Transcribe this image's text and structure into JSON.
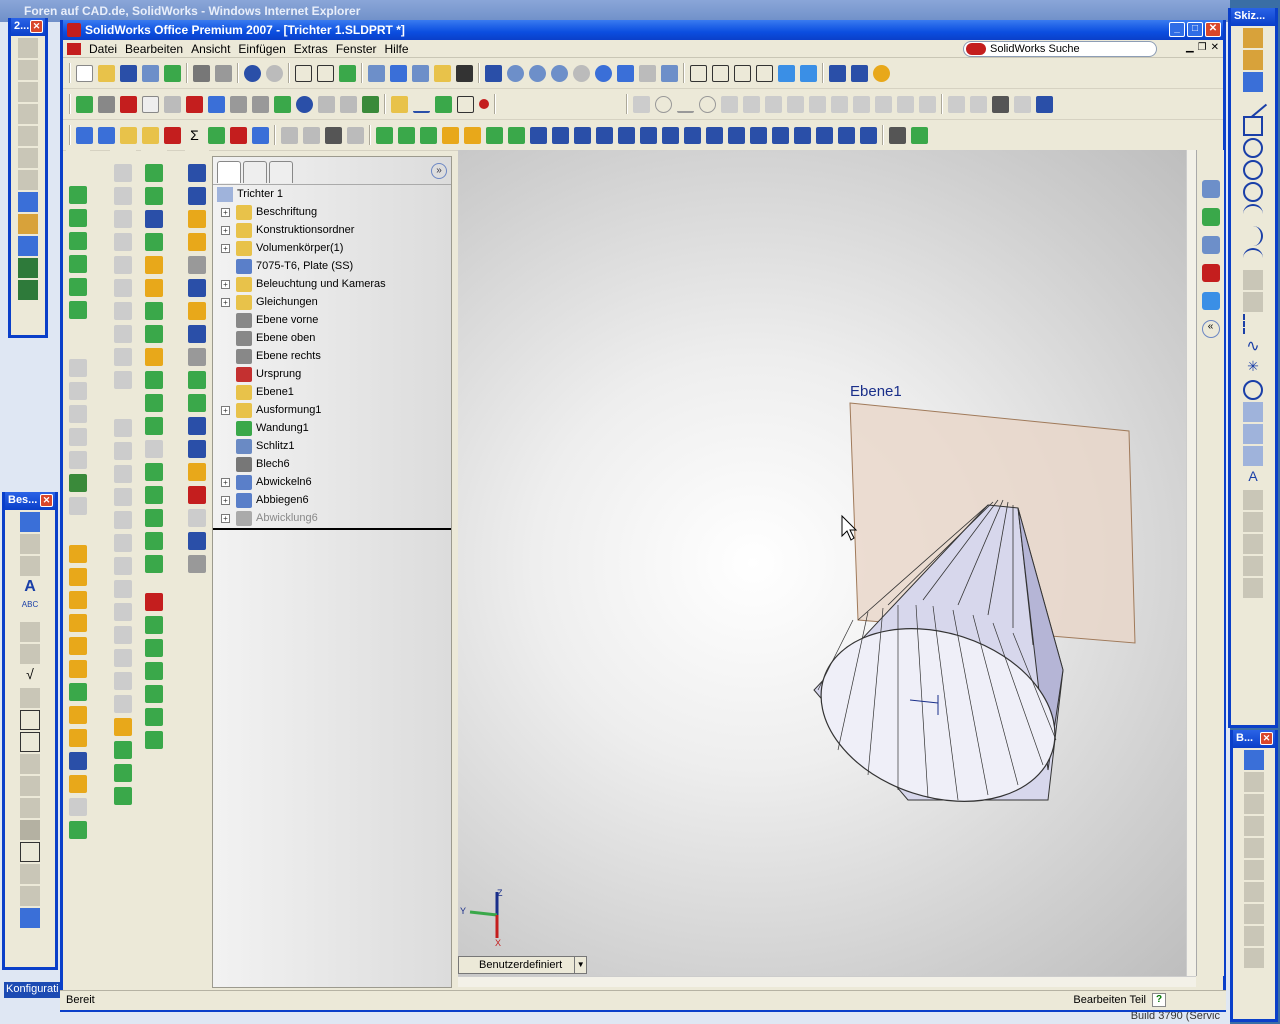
{
  "background_window": {
    "title": "Foren auf CAD.de, SolidWorks - Windows Internet Explorer",
    "status_tail": "Build 3790 (Servic",
    "taskbar_item": "Konfigurati"
  },
  "floating_toolbars": {
    "left_top_title": "2...",
    "left_bottom_title": "Bes...",
    "right_top_title": "Skiz...",
    "right_bottom_title": "B..."
  },
  "window": {
    "title": "SolidWorks Office Premium 2007 - [Trichter 1.SLDPRT *]",
    "minimize": "_",
    "maximize": "□",
    "close": "✕"
  },
  "menu": {
    "items": [
      "Datei",
      "Bearbeiten",
      "Ansicht",
      "Einfügen",
      "Extras",
      "Fenster",
      "Hilfe"
    ],
    "search_label": "SolidWorks Suche"
  },
  "feature_tree": {
    "root": "Trichter 1",
    "items": [
      {
        "label": "Beschriftung",
        "expandable": true,
        "icon": "annotation-icon",
        "color": "#e8c24a"
      },
      {
        "label": "Konstruktionsordner",
        "expandable": true,
        "icon": "design-binder-icon",
        "color": "#e8c24a"
      },
      {
        "label": "Volumenkörper(1)",
        "expandable": true,
        "icon": "solid-bodies-icon",
        "color": "#e8c24a"
      },
      {
        "label": "7075-T6, Plate (SS)",
        "expandable": false,
        "icon": "material-icon",
        "color": "#5a7fc9"
      },
      {
        "label": "Beleuchtung und Kameras",
        "expandable": true,
        "icon": "lights-icon",
        "color": "#e8c24a"
      },
      {
        "label": "Gleichungen",
        "expandable": true,
        "icon": "equations-icon",
        "color": "#e8c24a"
      },
      {
        "label": "Ebene vorne",
        "expandable": false,
        "icon": "plane-icon",
        "color": "#888888"
      },
      {
        "label": "Ebene oben",
        "expandable": false,
        "icon": "plane-icon",
        "color": "#888888"
      },
      {
        "label": "Ebene rechts",
        "expandable": false,
        "icon": "plane-icon",
        "color": "#888888"
      },
      {
        "label": "Ursprung",
        "expandable": false,
        "icon": "origin-icon",
        "color": "#c43030"
      },
      {
        "label": "Ebene1",
        "expandable": false,
        "icon": "plane-icon",
        "color": "#e8c24a"
      },
      {
        "label": "Ausformung1",
        "expandable": true,
        "icon": "loft-icon",
        "color": "#e8c24a"
      },
      {
        "label": "Wandung1",
        "expandable": false,
        "icon": "shell-icon",
        "color": "#3aa84a"
      },
      {
        "label": "Schlitz1",
        "expandable": false,
        "icon": "rip-icon",
        "color": "#6a8ac4"
      },
      {
        "label": "Blech6",
        "expandable": false,
        "icon": "sheet-metal-icon",
        "color": "#777777"
      },
      {
        "label": "Abwickeln6",
        "expandable": true,
        "icon": "unfold-icon",
        "color": "#5a7fc9"
      },
      {
        "label": "Abbiegen6",
        "expandable": true,
        "icon": "fold-icon",
        "color": "#5a7fc9"
      },
      {
        "label": "Abwicklung6",
        "expandable": true,
        "icon": "flat-pattern-icon",
        "color": "#aaaaaa",
        "dimmed": true
      }
    ]
  },
  "viewport": {
    "plane_label": "Ebene1",
    "triad": {
      "x": "X",
      "y": "Y",
      "z": "Z"
    },
    "config_tab": "Benutzerdefiniert"
  },
  "status": {
    "left": "Bereit",
    "mode": "Bearbeiten Teil",
    "help": "?"
  }
}
